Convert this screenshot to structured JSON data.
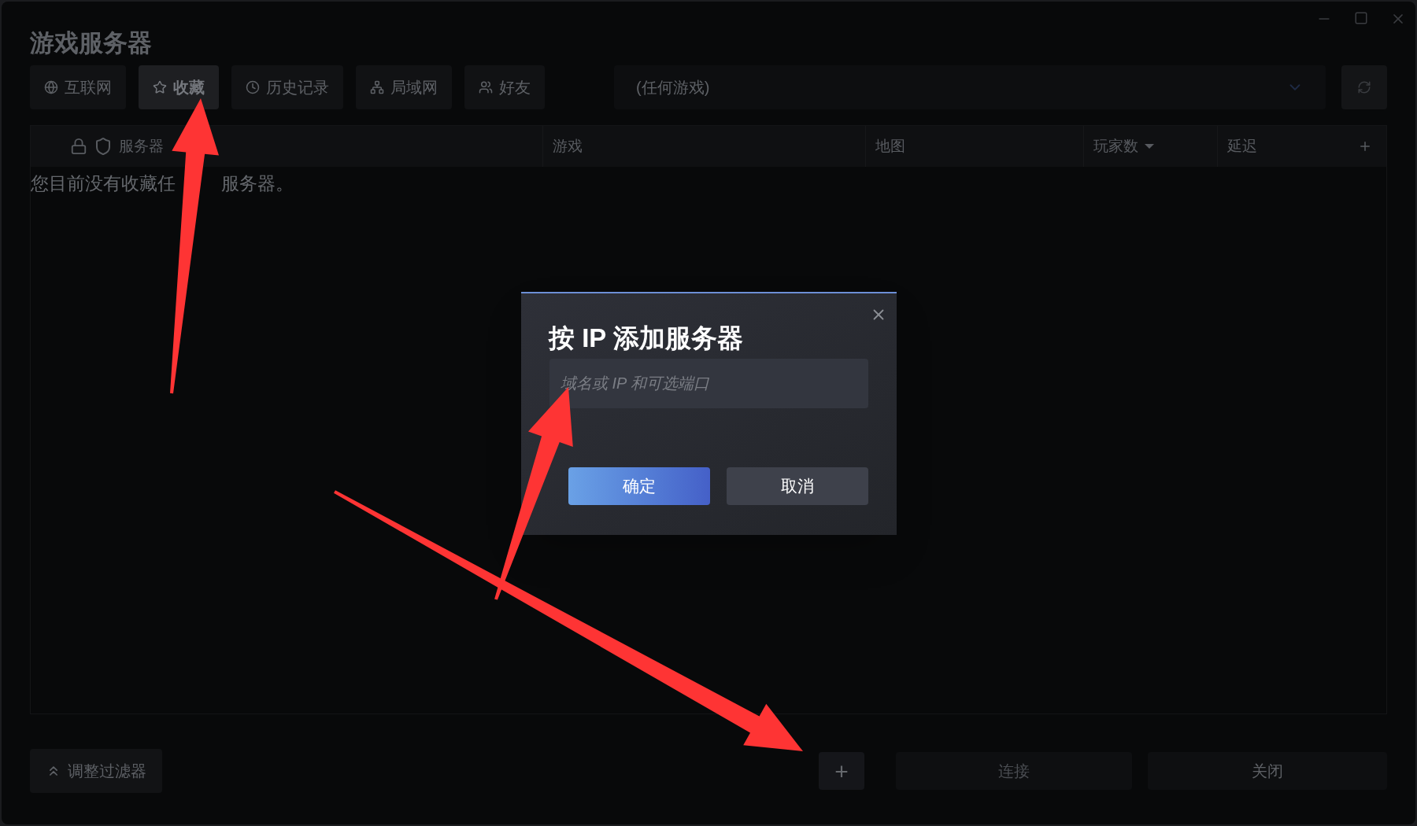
{
  "window": {
    "title": "游戏服务器"
  },
  "tabs": [
    {
      "label": "互联网",
      "selected": false
    },
    {
      "label": "收藏",
      "selected": true
    },
    {
      "label": "历史记录",
      "selected": false
    },
    {
      "label": "局域网",
      "selected": false
    },
    {
      "label": "好友",
      "selected": false
    }
  ],
  "game_filter": {
    "value": "(任何游戏)"
  },
  "table": {
    "columns": [
      {
        "label": "服务器",
        "sorted": false
      },
      {
        "label": "游戏",
        "sorted": false
      },
      {
        "label": "地图",
        "sorted": false
      },
      {
        "label": "玩家数",
        "sorted": true
      },
      {
        "label": "延迟",
        "sorted": false
      }
    ],
    "empty_message": [
      "您目前没有收藏任",
      "服务器。"
    ]
  },
  "bottom": {
    "filter_button": "调整过滤器",
    "add_button": "+",
    "connect_button": {
      "label": "连接",
      "disabled": true
    },
    "close_button": "关闭"
  },
  "dialog": {
    "title": "按 IP 添加服务器",
    "placeholder": "域名或 IP 和可选端口",
    "ok": "确定",
    "cancel": "取消"
  }
}
